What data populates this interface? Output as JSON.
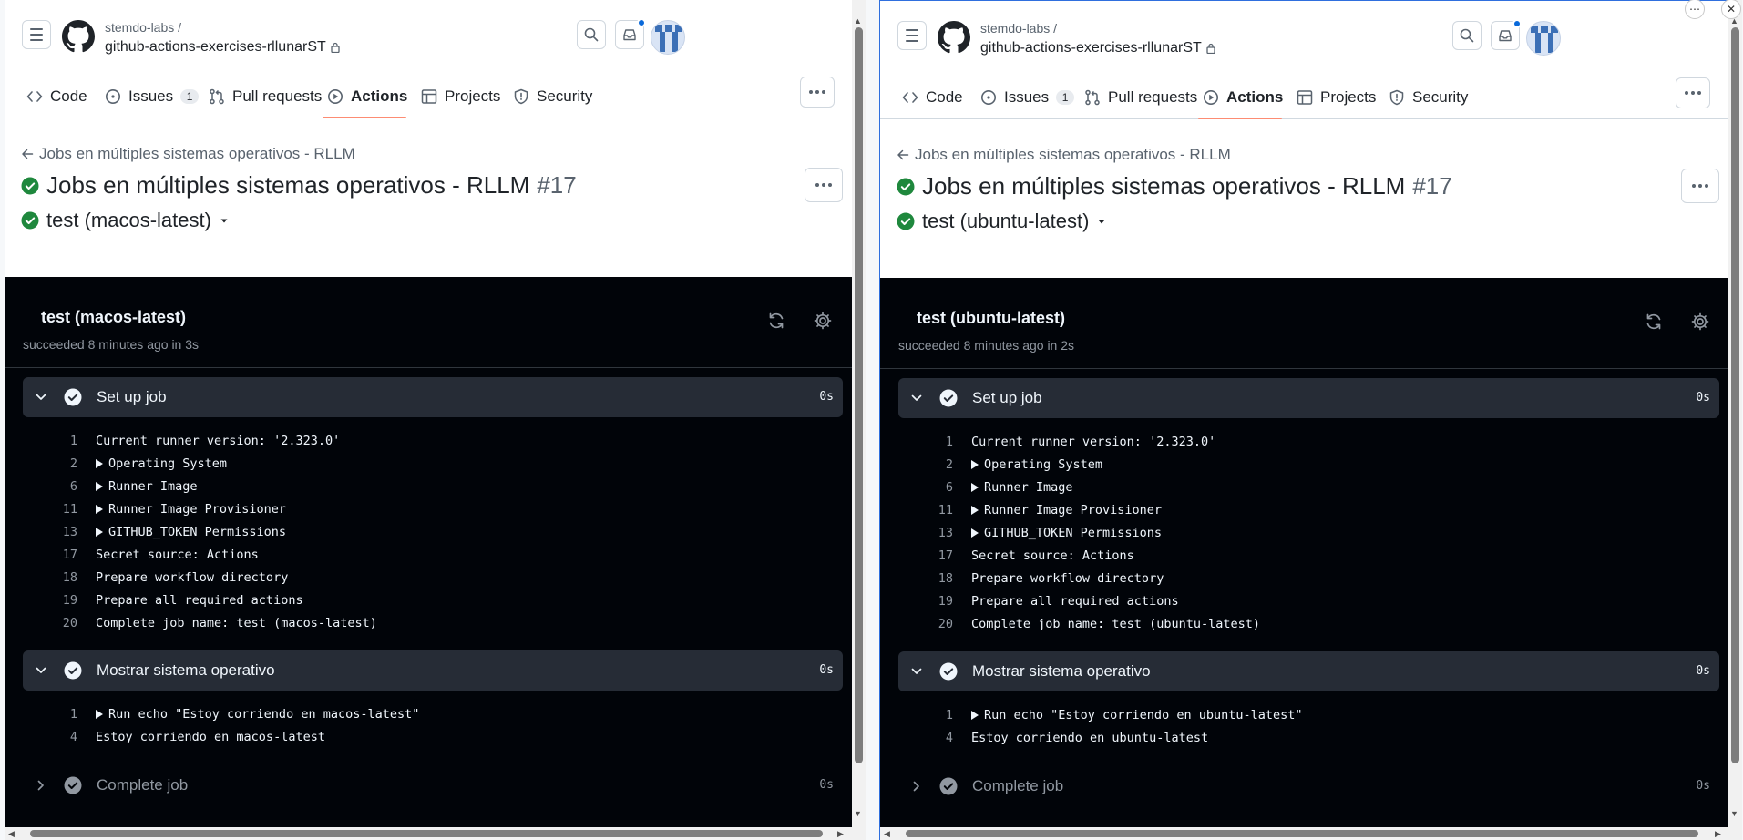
{
  "panes": [
    {
      "owner": "stemdo-labs /",
      "repo": "github-actions-exercises-rllunarST",
      "nav": [
        {
          "label": "Code",
          "icon": "code-icon"
        },
        {
          "label": "Issues",
          "icon": "issue-icon",
          "count": "1"
        },
        {
          "label": "Pull requests",
          "icon": "pull-request-icon"
        },
        {
          "label": "Actions",
          "icon": "actions-play-icon",
          "active": true
        },
        {
          "label": "Projects",
          "icon": "table-icon"
        },
        {
          "label": "Security",
          "icon": "shield-icon"
        }
      ],
      "back_link": "Jobs en múltiples sistemas operativos - RLLM",
      "run_title": "Jobs en múltiples sistemas operativos - RLLM",
      "run_number": "#17",
      "job_name": "test (macos-latest)",
      "log": {
        "title": "test (macos-latest)",
        "subtitle": "succeeded 8 minutes ago in 3s",
        "steps": [
          {
            "name": "Set up job",
            "duration": "0s",
            "lines": [
              {
                "n": "1",
                "text": "Current runner version: '2.323.0'"
              },
              {
                "n": "2",
                "text": "Operating System",
                "expandable": true
              },
              {
                "n": "6",
                "text": "Runner Image",
                "expandable": true
              },
              {
                "n": "11",
                "text": "Runner Image Provisioner",
                "expandable": true
              },
              {
                "n": "13",
                "text": "GITHUB_TOKEN Permissions",
                "expandable": true
              },
              {
                "n": "17",
                "text": "Secret source: Actions"
              },
              {
                "n": "18",
                "text": "Prepare workflow directory"
              },
              {
                "n": "19",
                "text": "Prepare all required actions"
              },
              {
                "n": "20",
                "text": "Complete job name: test (macos-latest)"
              }
            ]
          },
          {
            "name": "Mostrar sistema operativo",
            "duration": "0s",
            "lines": [
              {
                "n": "1",
                "text": "Run echo \"Estoy corriendo en macos-latest\"",
                "expandable": true
              },
              {
                "n": "4",
                "text": "Estoy corriendo en macos-latest"
              }
            ]
          },
          {
            "name": "Complete job",
            "duration": "0s",
            "collapsed": true
          }
        ]
      }
    },
    {
      "owner": "stemdo-labs /",
      "repo": "github-actions-exercises-rllunarST",
      "nav": [
        {
          "label": "Code",
          "icon": "code-icon"
        },
        {
          "label": "Issues",
          "icon": "issue-icon",
          "count": "1"
        },
        {
          "label": "Pull requests",
          "icon": "pull-request-icon"
        },
        {
          "label": "Actions",
          "icon": "actions-play-icon",
          "active": true
        },
        {
          "label": "Projects",
          "icon": "table-icon"
        },
        {
          "label": "Security",
          "icon": "shield-icon"
        }
      ],
      "back_link": "Jobs en múltiples sistemas operativos - RLLM",
      "run_title": "Jobs en múltiples sistemas operativos - RLLM",
      "run_number": "#17",
      "job_name": "test (ubuntu-latest)",
      "log": {
        "title": "test (ubuntu-latest)",
        "subtitle": "succeeded 8 minutes ago in 2s",
        "steps": [
          {
            "name": "Set up job",
            "duration": "0s",
            "lines": [
              {
                "n": "1",
                "text": "Current runner version: '2.323.0'"
              },
              {
                "n": "2",
                "text": "Operating System",
                "expandable": true
              },
              {
                "n": "6",
                "text": "Runner Image",
                "expandable": true
              },
              {
                "n": "11",
                "text": "Runner Image Provisioner",
                "expandable": true
              },
              {
                "n": "13",
                "text": "GITHUB_TOKEN Permissions",
                "expandable": true
              },
              {
                "n": "17",
                "text": "Secret source: Actions"
              },
              {
                "n": "18",
                "text": "Prepare workflow directory"
              },
              {
                "n": "19",
                "text": "Prepare all required actions"
              },
              {
                "n": "20",
                "text": "Complete job name: test (ubuntu-latest)"
              }
            ]
          },
          {
            "name": "Mostrar sistema operativo",
            "duration": "0s",
            "lines": [
              {
                "n": "1",
                "text": "Run echo \"Estoy corriendo en ubuntu-latest\"",
                "expandable": true
              },
              {
                "n": "4",
                "text": "Estoy corriendo en ubuntu-latest"
              }
            ]
          },
          {
            "name": "Complete job",
            "duration": "0s",
            "collapsed": true
          }
        ]
      }
    }
  ],
  "colors": {
    "success": "#1f883d",
    "accent_underline": "#fd8c73",
    "log_bg": "#010409",
    "step_bg": "#262c36",
    "notification_dot": "#0969da",
    "focus_border": "#2f6fde"
  }
}
